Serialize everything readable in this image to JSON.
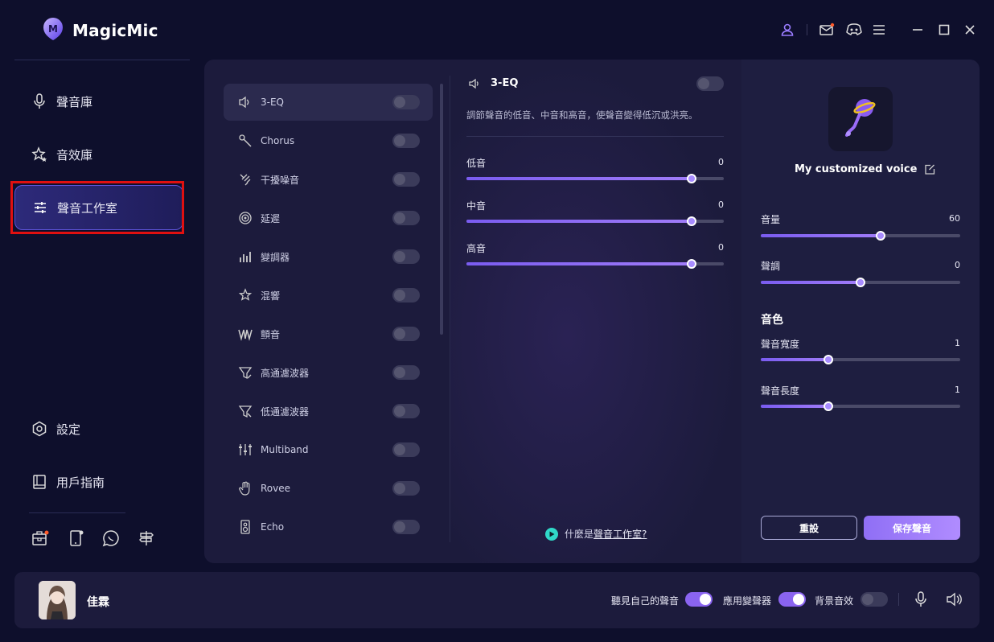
{
  "app": {
    "title": "MagicMic"
  },
  "sidebar": {
    "items": [
      {
        "label": "聲音庫",
        "icon": "microphone-icon"
      },
      {
        "label": "音效庫",
        "icon": "sparkle-star-icon"
      },
      {
        "label": "聲音工作室",
        "icon": "sliders-icon"
      }
    ],
    "bottom_items": [
      {
        "label": "設定",
        "icon": "gear-icon"
      },
      {
        "label": "用戶指南",
        "icon": "book-icon"
      }
    ]
  },
  "effects": [
    {
      "label": "3-EQ",
      "icon": "speaker-icon",
      "enabled": false
    },
    {
      "label": "Chorus",
      "icon": "chorus-icon",
      "enabled": false
    },
    {
      "label": "干擾噪音",
      "icon": "noise-icon",
      "enabled": false
    },
    {
      "label": "延遲",
      "icon": "delay-icon",
      "enabled": false
    },
    {
      "label": "變調器",
      "icon": "bars-icon",
      "enabled": false
    },
    {
      "label": "混響",
      "icon": "reverb-icon",
      "enabled": false
    },
    {
      "label": "顫音",
      "icon": "tremolo-icon",
      "enabled": false
    },
    {
      "label": "高通濾波器",
      "icon": "highpass-filter-icon",
      "enabled": false
    },
    {
      "label": "低通濾波器",
      "icon": "lowpass-filter-icon",
      "enabled": false
    },
    {
      "label": "Multiband",
      "icon": "multiband-icon",
      "enabled": false
    },
    {
      "label": "Rovee",
      "icon": "hand-icon",
      "enabled": false
    },
    {
      "label": "Echo",
      "icon": "echo-icon",
      "enabled": false
    }
  ],
  "eq": {
    "title": "3-EQ",
    "enabled": false,
    "description": "調節聲音的低音、中音和高音，使聲音變得低沉或洪亮。",
    "sliders": [
      {
        "label": "低音",
        "value": "0",
        "level": 0.875
      },
      {
        "label": "中音",
        "value": "0",
        "level": 0.875
      },
      {
        "label": "高音",
        "value": "0",
        "level": 0.875
      }
    ],
    "help_prefix": "什麼是",
    "help_link": "聲音工作室?"
  },
  "voice": {
    "name": "My customized voice",
    "sliders": [
      {
        "label": "音量",
        "value": "60",
        "level": 0.6
      },
      {
        "label": "聲調",
        "value": "0",
        "level": 0.5
      }
    ],
    "tone_heading": "音色",
    "tone_sliders": [
      {
        "label": "聲音寬度",
        "value": "1",
        "level": 0.34
      },
      {
        "label": "聲音長度",
        "value": "1",
        "level": 0.34
      }
    ],
    "reset_label": "重設",
    "save_label": "保存聲音"
  },
  "footer": {
    "user_name": "佳霖",
    "toggles": [
      {
        "label": "聽見自己的聲音",
        "on": true
      },
      {
        "label": "應用變聲器",
        "on": true
      },
      {
        "label": "背景音效",
        "on": false
      }
    ]
  },
  "colors": {
    "accent": "#8a64f0",
    "highlight": "#e01010",
    "background": "#0e0f2c"
  }
}
